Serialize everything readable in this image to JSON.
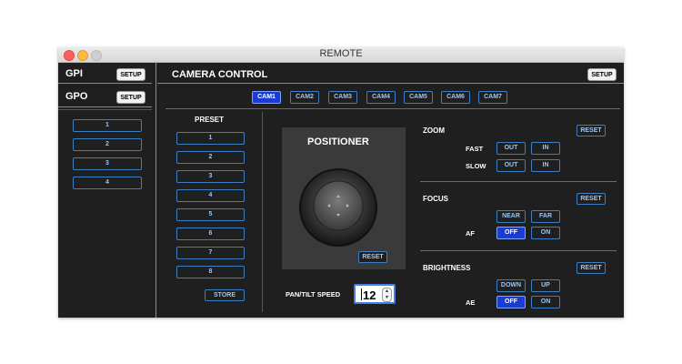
{
  "window": {
    "title": "REMOTE"
  },
  "sidebar": {
    "gpi_label": "GPI",
    "gpo_label": "GPO",
    "setup_label": "SETUP",
    "gpo_buttons": [
      "1",
      "2",
      "3",
      "4"
    ]
  },
  "main": {
    "title": "CAMERA CONTROL",
    "setup_label": "SETUP",
    "cams": [
      {
        "label": "CAM1",
        "active": true
      },
      {
        "label": "CAM2",
        "active": false
      },
      {
        "label": "CAM3",
        "active": false
      },
      {
        "label": "CAM4",
        "active": false
      },
      {
        "label": "CAM5",
        "active": false
      },
      {
        "label": "CAM6",
        "active": false
      },
      {
        "label": "CAM7",
        "active": false
      }
    ]
  },
  "preset": {
    "title": "PRESET",
    "buttons": [
      "1",
      "2",
      "3",
      "4",
      "5",
      "6",
      "7",
      "8"
    ],
    "store_label": "STORE"
  },
  "positioner": {
    "title": "POSITIONER",
    "reset_label": "RESET",
    "speed_label": "PAN/TILT SPEED",
    "speed_value": "12"
  },
  "zoom": {
    "title": "ZOOM",
    "reset_label": "RESET",
    "fast_label": "FAST",
    "slow_label": "SLOW",
    "out_label": "OUT",
    "in_label": "IN"
  },
  "focus": {
    "title": "FOCUS",
    "reset_label": "RESET",
    "near_label": "NEAR",
    "far_label": "FAR",
    "af_label": "AF",
    "off_label": "OFF",
    "on_label": "ON"
  },
  "brightness": {
    "title": "BRIGHTNESS",
    "reset_label": "RESET",
    "down_label": "DOWN",
    "up_label": "UP",
    "ae_label": "AE",
    "off_label": "OFF",
    "on_label": "ON"
  },
  "colors": {
    "accent": "#1a3cd4",
    "button_border": "#3a7fc4",
    "panel_bg": "#1f1f1f"
  }
}
